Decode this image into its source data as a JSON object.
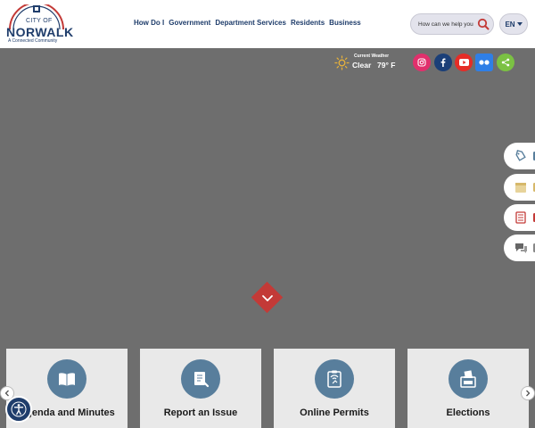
{
  "logo": {
    "small": "CITY OF",
    "big": "NORWALK",
    "tagline": "A Connected Community"
  },
  "nav": [
    "How Do I",
    "Government",
    "Department Services",
    "Residents",
    "Business"
  ],
  "search": {
    "placeholder": "How can we help you"
  },
  "language": {
    "label": "EN"
  },
  "weather": {
    "title": "Current Weather",
    "condition": "Clear",
    "temperature": "79° F"
  },
  "social": [
    {
      "name": "instagram-icon",
      "color": "#e1306c"
    },
    {
      "name": "facebook-icon",
      "color": "#1b3f78"
    },
    {
      "name": "youtube-icon",
      "color": "#e52d27"
    },
    {
      "name": "flickr-icon",
      "color": "#2f7fe6"
    },
    {
      "name": "share-icon",
      "color": "#7bc143"
    }
  ],
  "side_tabs": [
    {
      "name": "tag-icon",
      "edge_color": "#587e9c"
    },
    {
      "name": "calendar-icon",
      "edge_color": "#d6b86a"
    },
    {
      "name": "newspaper-icon",
      "edge_color": "#c33a37"
    },
    {
      "name": "chat-icon",
      "edge_color": "#888888"
    }
  ],
  "cards": [
    {
      "label": "Agenda and Minutes",
      "icon": "book-icon"
    },
    {
      "label": "Report an Issue",
      "icon": "report-icon"
    },
    {
      "label": "Online Permits",
      "icon": "permit-icon"
    },
    {
      "label": "Elections",
      "icon": "ballot-box-icon"
    }
  ],
  "colors": {
    "navy": "#1f3d6b",
    "red": "#c33a37",
    "card_icon_bg": "#587e9c",
    "hero_bg": "#6e6e6e"
  }
}
